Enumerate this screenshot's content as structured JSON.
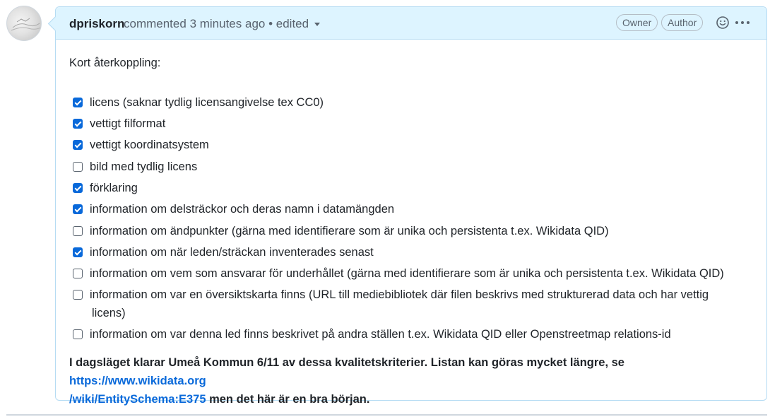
{
  "comment": {
    "author": "dpriskorn",
    "action": "commented",
    "time": "3 minutes ago",
    "edited": "• edited",
    "badges": {
      "owner": "Owner",
      "author": "Author"
    },
    "intro": "Kort återkoppling:",
    "tasks": [
      {
        "checked": true,
        "text": "licens (saknar tydlig licensangivelse tex CC0)"
      },
      {
        "checked": true,
        "text": "vettigt filformat"
      },
      {
        "checked": true,
        "text": "vettigt koordinatsystem"
      },
      {
        "checked": false,
        "text": "bild med tydlig licens"
      },
      {
        "checked": true,
        "text": "förklaring"
      },
      {
        "checked": true,
        "text": "information om delsträckor och deras namn i datamängden"
      },
      {
        "checked": false,
        "text": "information om ändpunkter (gärna med identifierare som är unika och persistenta t.ex. Wikidata QID)"
      },
      {
        "checked": true,
        "text": "information om när leden/sträckan inventerades senast"
      },
      {
        "checked": false,
        "text": "information om vem som ansvarar för underhållet (gärna med identifierare som är unika och persistenta t.ex. Wikidata QID)"
      },
      {
        "checked": false,
        "text": "information om var en översiktskarta finns (URL till mediebibliotek där filen beskrivs med strukturerad data och har vettig",
        "text2": "licens)"
      },
      {
        "checked": false,
        "text": "information om var denna led finns beskrivet på andra ställen t.ex. Wikidata QID eller Openstreetmap relations-id"
      }
    ],
    "summary_before": "I dagsläget klarar Umeå Kommun 6/11 av dessa kvalitetskriterier. Listan kan göras mycket längre, se ",
    "summary_link": "https://www.wikidata.org/wiki/EntitySchema:E375",
    "summary_link_line1": "https://www.wikidata.org",
    "summary_link_line2": "/wiki/EntitySchema:E375",
    "summary_after": " men det här är en bra början."
  },
  "icons": {
    "reaction": "smiley-icon",
    "menu": "kebab-horizontal-icon",
    "dropdown": "triangle-down-icon"
  },
  "colors": {
    "header_bg": "#ddf4ff",
    "border": "#b6dcf3",
    "link": "#0969da",
    "checkbox_checked": "#0969da"
  }
}
